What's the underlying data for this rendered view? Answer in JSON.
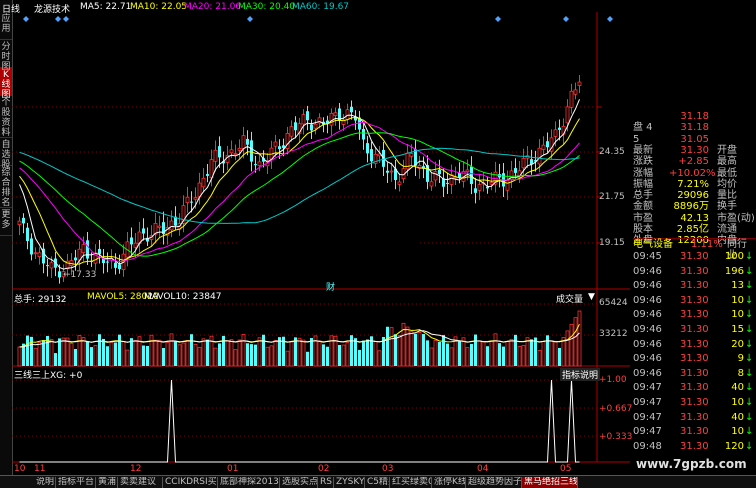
{
  "sidebar": {
    "items": [
      "日线",
      "应用",
      "分时图",
      "K线图",
      "个股资料",
      "自选股",
      "综合排名",
      "更多"
    ]
  },
  "header": {
    "title": "龙源技术",
    "ma5": "MA5: 22.71",
    "ma10": "MA10: 22.05",
    "ma20": "MA20: 21.06",
    "ma30": "MA30: 20.40",
    "ma60": "MA60: 19.67"
  },
  "colors": {
    "ma5": "#ffffff",
    "ma10": "#ffff00",
    "ma20": "#ff00ff",
    "ma30": "#00ff00",
    "ma60": "#00c8c8",
    "up": "#ff3030",
    "down": "#54ffff",
    "grid": "#800000"
  },
  "price_axis": [
    "24.35",
    "21.75",
    "19.15"
  ],
  "low_label": "←17.33",
  "cai_label": "财",
  "volume": {
    "total": "总手: 29132",
    "mavol5": "MAVOL5: 28020",
    "mavol10": "MAVOL10: 23847",
    "panel_label": "成交量",
    "axis": [
      "65424",
      "33212"
    ]
  },
  "indicator": {
    "name": "三线三上XG: +0",
    "explain": "指标说明",
    "axis": [
      "+1.00",
      "+0.667",
      "+0.333"
    ]
  },
  "date_axis": [
    "10",
    "11",
    "12",
    "01",
    "02",
    "03",
    "04",
    "05"
  ],
  "quote": {
    "rows": [
      {
        "l": "",
        "v": "31.18",
        "v2": ""
      },
      {
        "l": "盘  4",
        "v": "31.18",
        "v2": ""
      },
      {
        "l": "    5",
        "v": "31.05",
        "v2": ""
      },
      {
        "l": "最新",
        "v": "31.30",
        "l2": "开盘"
      },
      {
        "l": "涨跌",
        "v": "+2.85",
        "l2": "最高"
      },
      {
        "l": "涨幅",
        "v": "+10.02%",
        "l2": "最低"
      },
      {
        "l": "振幅",
        "v": "7.21%",
        "l2": "均价"
      },
      {
        "l": "总手",
        "v": "29096",
        "l2": "量比"
      },
      {
        "l": "金额",
        "v": "8896万",
        "l2": "换手"
      },
      {
        "l": "市盈",
        "v": "42.13",
        "l2": "市盈(动)"
      },
      {
        "l": "股本",
        "v": "2.85亿",
        "l2": "流通"
      },
      {
        "l": "外盘",
        "v": "12200",
        "l2": "内盘"
      }
    ]
  },
  "sector": {
    "name": "电气设备",
    "pct": "1.11%",
    "extra": "同行业"
  },
  "ticks": [
    {
      "t": "09:45",
      "p": "31.30",
      "v": "100"
    },
    {
      "t": "09:46",
      "p": "31.30",
      "v": "196"
    },
    {
      "t": "09:46",
      "p": "31.30",
      "v": "13"
    },
    {
      "t": "09:46",
      "p": "31.30",
      "v": "10"
    },
    {
      "t": "09:46",
      "p": "31.30",
      "v": "10"
    },
    {
      "t": "09:46",
      "p": "31.30",
      "v": "15"
    },
    {
      "t": "09:46",
      "p": "31.30",
      "v": "20"
    },
    {
      "t": "09:46",
      "p": "31.30",
      "v": "9"
    },
    {
      "t": "09:46",
      "p": "31.30",
      "v": "8"
    },
    {
      "t": "09:47",
      "p": "31.30",
      "v": "40"
    },
    {
      "t": "09:47",
      "p": "31.30",
      "v": "10"
    },
    {
      "t": "09:47",
      "p": "31.30",
      "v": "40"
    },
    {
      "t": "09:47",
      "p": "31.30",
      "v": "10"
    },
    {
      "t": "09:48",
      "p": "31.30",
      "v": "120"
    }
  ],
  "tabs": [
    "说明",
    "指标平台",
    "黄浦",
    "卖卖建议",
    "CCIKDRSI买卖",
    "底部神探2013",
    "选股实点",
    "RS",
    "ZYSKY18",
    "C5精买",
    "红买绿卖00",
    "涨停K线",
    "超级趋势因子",
    "黑马绝招三线三"
  ],
  "watermark": "www.7gpzb.com"
}
